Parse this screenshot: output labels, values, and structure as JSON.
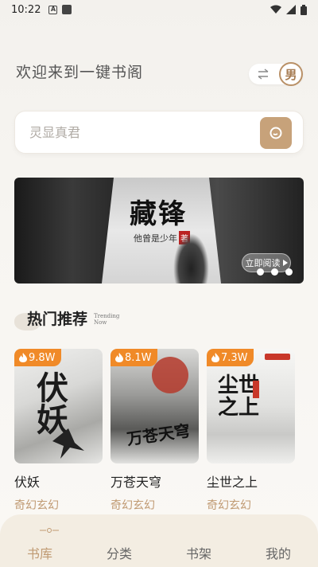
{
  "status_bar": {
    "time": "10:22",
    "icon_a": "A"
  },
  "header": {
    "welcome": "欢迎来到一键书阁",
    "gender_label": "男"
  },
  "search": {
    "placeholder": "灵显真君"
  },
  "banner": {
    "title": "藏锋",
    "author": "他曾是少年",
    "author_seal": "著",
    "read_button": "立即阅读",
    "dots": 3
  },
  "section": {
    "title": "热门推荐",
    "subtitle_line1": "Trending",
    "subtitle_line2": "Now"
  },
  "books": [
    {
      "name": "伏妖",
      "genre": "奇幻玄幻",
      "heat": "9.8W",
      "cover_text": "伏妖"
    },
    {
      "name": "万苍天穹",
      "genre": "奇幻玄幻",
      "heat": "8.1W",
      "cover_text": "万苍天穹"
    },
    {
      "name": "尘世之上",
      "genre": "奇幻玄幻",
      "heat": "7.3W",
      "cover_text": "尘世之上"
    }
  ],
  "bottom_nav": {
    "items": [
      {
        "label": "书库",
        "active": true
      },
      {
        "label": "分类",
        "active": false
      },
      {
        "label": "书架",
        "active": false
      },
      {
        "label": "我的",
        "active": false
      }
    ]
  },
  "colors": {
    "accent": "#c09a72",
    "heat_badge": "#f08a28",
    "search_button": "#c7a27a"
  },
  "icons": {
    "search_button": "search-icon",
    "gender_toggle": "swap-icon",
    "heat": "fire-icon",
    "status_wifi": "wifi-icon",
    "status_signal": "signal-icon",
    "status_battery": "battery-icon"
  }
}
